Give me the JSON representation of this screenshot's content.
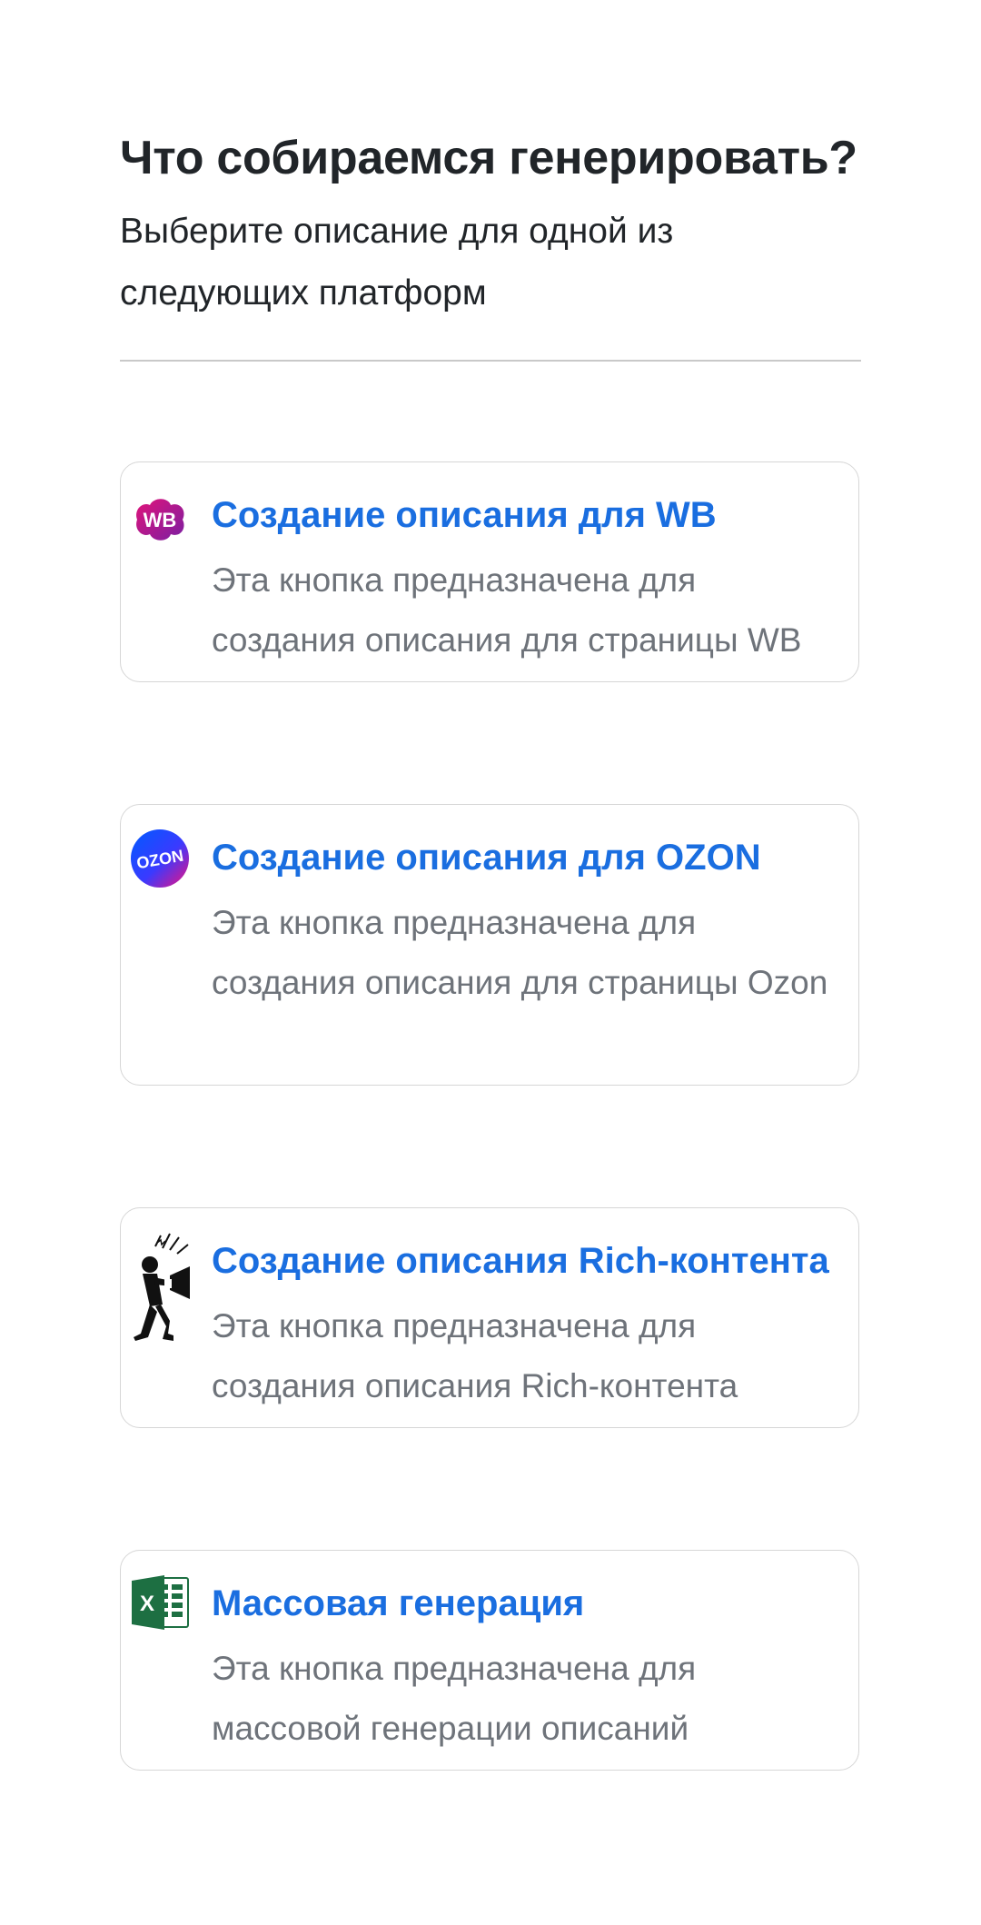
{
  "header": {
    "title": "Что собираемся генерировать?",
    "subtitle": "Выберите описание для одной из следующих платформ"
  },
  "options": [
    {
      "title": "Создание описания для WB",
      "description": "Эта кнопка предназначена для создания описания для страницы WB",
      "icon": "wildberries-logo-icon",
      "icon_text": "WB",
      "icon_color": "#cb11ab"
    },
    {
      "title": "Создание описания для OZON",
      "description": "Эта кнопка предназначена для создания описания для страницы Ozon",
      "icon": "ozon-logo-icon",
      "icon_text": "OZON",
      "icon_color": "#005bff"
    },
    {
      "title": "Создание описания Rich-контента",
      "description": "Эта кнопка предназначена для создания описания Rich-контента",
      "icon": "megaphone-man-icon"
    },
    {
      "title": "Массовая генерация",
      "description": "Эта кнопка предназначена для массовой генерации описаний",
      "icon": "excel-icon",
      "icon_text": "X",
      "icon_color": "#1d6f42"
    }
  ],
  "colors": {
    "accent": "#1a6ee0",
    "heading": "#212529",
    "muted": "#6e737a",
    "border": "#d6d6d6"
  }
}
